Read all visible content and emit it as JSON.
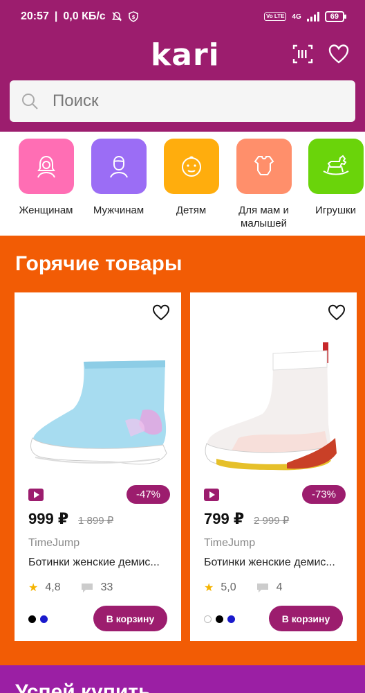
{
  "status": {
    "time": "20:57",
    "speed": "0,0 КБ/с",
    "network": "4G",
    "lte": "Vo LTE",
    "battery": "69"
  },
  "header": {
    "logo": "kari",
    "search_placeholder": "Поиск"
  },
  "categories": [
    {
      "label": "Женщинам",
      "color": "#ff6eb4",
      "icon": "woman-icon"
    },
    {
      "label": "Мужчинам",
      "color": "#9b6df5",
      "icon": "man-icon"
    },
    {
      "label": "Детям",
      "color": "#ffad0d",
      "icon": "baby-face-icon"
    },
    {
      "label": "Для мам и малышей",
      "color": "#ff8f6b",
      "icon": "bodysuit-icon"
    },
    {
      "label": "Игрушки",
      "color": "#6ad40a",
      "icon": "rocking-horse-icon"
    }
  ],
  "hot": {
    "title": "Горячие товары",
    "products": [
      {
        "discount": "-47%",
        "price": "999 ₽",
        "old_price": "1 899 ₽",
        "brand": "TimeJump",
        "name": "Ботинки женские демис...",
        "rating": "4,8",
        "reviews": "33",
        "colors": [
          "#000000",
          "#1a1acc"
        ],
        "cart_label": "В корзину"
      },
      {
        "discount": "-73%",
        "price": "799 ₽",
        "old_price": "2 999 ₽",
        "brand": "TimeJump",
        "name": "Ботинки женские демис...",
        "rating": "5,0",
        "reviews": "4",
        "colors": [
          "#ffffff",
          "#000000",
          "#1a1acc"
        ],
        "cart_label": "В корзину"
      }
    ]
  },
  "next_section": {
    "title": "Успей купить"
  },
  "colors": {
    "brand": "#9c1d6e",
    "hot_bg": "#f25c05",
    "next_bg": "#9b1fa4"
  }
}
